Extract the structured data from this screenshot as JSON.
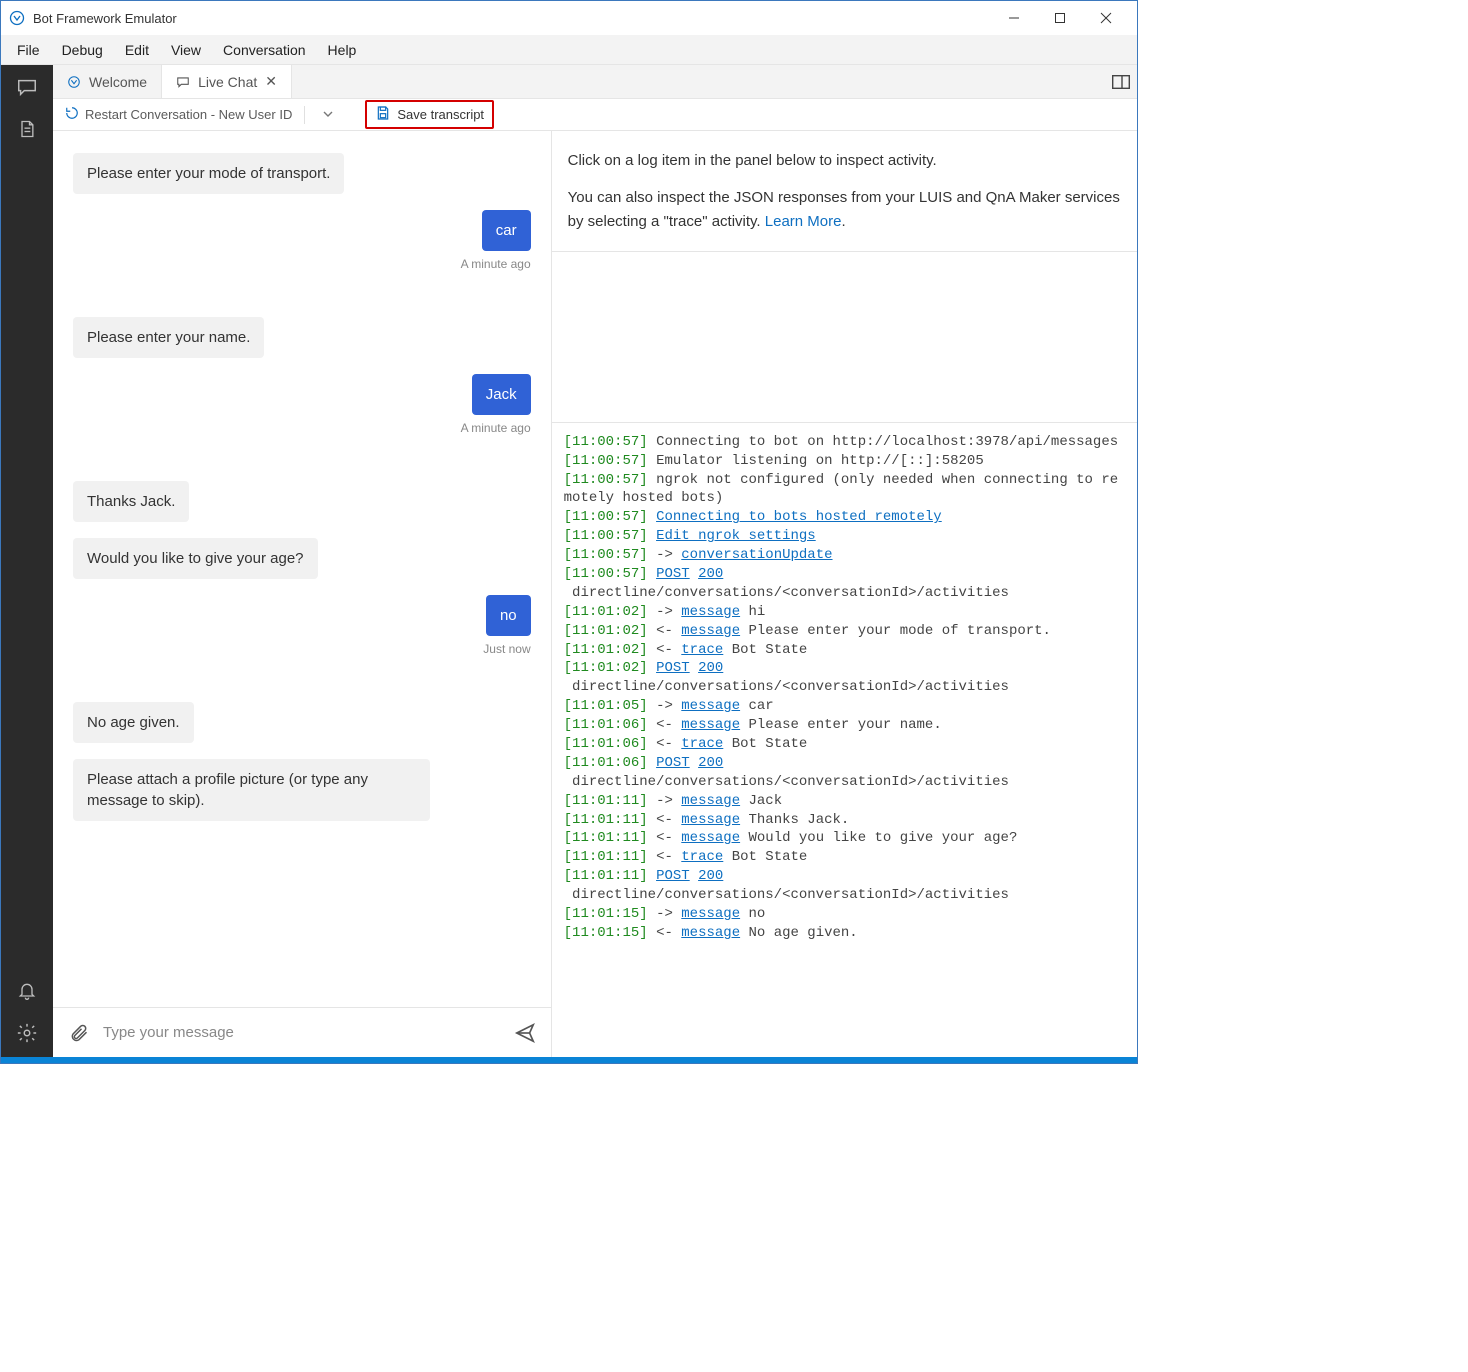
{
  "window": {
    "title": "Bot Framework Emulator"
  },
  "menu": {
    "items": [
      "File",
      "Debug",
      "Edit",
      "View",
      "Conversation",
      "Help"
    ]
  },
  "tabs": {
    "welcome": "Welcome",
    "livechat": "Live Chat"
  },
  "toolbar": {
    "restart": "Restart Conversation - New User ID",
    "save_transcript": "Save transcript"
  },
  "chat": {
    "messages": [
      {
        "side": "bot",
        "text": "Please enter your mode of transport."
      },
      {
        "side": "user",
        "text": "car",
        "ts": "A minute ago"
      },
      {
        "side": "bot",
        "text": "Please enter your name."
      },
      {
        "side": "user",
        "text": "Jack",
        "ts": "A minute ago"
      },
      {
        "side": "bot",
        "text": "Thanks Jack."
      },
      {
        "side": "bot",
        "text": "Would you like to give your age?"
      },
      {
        "side": "user",
        "text": "no",
        "ts": "Just now"
      },
      {
        "side": "bot",
        "text": "No age given."
      },
      {
        "side": "bot",
        "text": "Please attach a profile picture (or type any message to skip)."
      }
    ],
    "input_placeholder": "Type your message"
  },
  "inspect": {
    "line1": "Click on a log item in the panel below to inspect activity.",
    "line2_a": "You can also inspect the JSON responses from your LUIS and QnA Maker services by selecting a \"trace\" activity. ",
    "learn_more": "Learn More",
    "period": "."
  },
  "log": {
    "entries": [
      {
        "t": "11:00:57",
        "parts": [
          {
            "v": "Connecting to bot on http://localhost:3978/api/messages"
          }
        ]
      },
      {
        "t": "11:00:57",
        "parts": [
          {
            "v": "Emulator listening on http://[::]:58205"
          }
        ]
      },
      {
        "t": "11:00:57",
        "parts": [
          {
            "v": "ngrok not configured (only needed when connecting to remotely hosted bots)"
          }
        ]
      },
      {
        "t": "11:00:57",
        "parts": [
          {
            "v": "Connecting to bots hosted remotely",
            "link": true
          }
        ]
      },
      {
        "t": "11:00:57",
        "parts": [
          {
            "v": "Edit ngrok settings",
            "link": true
          }
        ]
      },
      {
        "t": "11:00:57",
        "parts": [
          {
            "v": "-> "
          },
          {
            "v": "conversationUpdate",
            "link": true
          }
        ]
      },
      {
        "t": "11:00:57",
        "parts": [
          {
            "v": "POST",
            "link": true
          },
          {
            "v": " "
          },
          {
            "v": "200",
            "link": true
          }
        ],
        "tail": " directline/conversations/<conversationId>/activities"
      },
      {
        "t": "11:01:02",
        "parts": [
          {
            "v": "-> "
          },
          {
            "v": "message",
            "link": true
          },
          {
            "v": " hi"
          }
        ]
      },
      {
        "t": "11:01:02",
        "parts": [
          {
            "v": "<- "
          },
          {
            "v": "message",
            "link": true
          },
          {
            "v": " Please enter your mode of transport."
          }
        ]
      },
      {
        "t": "11:01:02",
        "parts": [
          {
            "v": "<- "
          },
          {
            "v": "trace",
            "link": true
          },
          {
            "v": " Bot State"
          }
        ]
      },
      {
        "t": "11:01:02",
        "parts": [
          {
            "v": "POST",
            "link": true
          },
          {
            "v": " "
          },
          {
            "v": "200",
            "link": true
          }
        ],
        "tail": " directline/conversations/<conversationId>/activities"
      },
      {
        "t": "11:01:05",
        "parts": [
          {
            "v": "-> "
          },
          {
            "v": "message",
            "link": true
          },
          {
            "v": " car"
          }
        ]
      },
      {
        "t": "11:01:06",
        "parts": [
          {
            "v": "<- "
          },
          {
            "v": "message",
            "link": true
          },
          {
            "v": " Please enter your name."
          }
        ]
      },
      {
        "t": "11:01:06",
        "parts": [
          {
            "v": "<- "
          },
          {
            "v": "trace",
            "link": true
          },
          {
            "v": " Bot State"
          }
        ]
      },
      {
        "t": "11:01:06",
        "parts": [
          {
            "v": "POST",
            "link": true
          },
          {
            "v": " "
          },
          {
            "v": "200",
            "link": true
          }
        ],
        "tail": " directline/conversations/<conversationId>/activities"
      },
      {
        "t": "11:01:11",
        "parts": [
          {
            "v": "-> "
          },
          {
            "v": "message",
            "link": true
          },
          {
            "v": " Jack"
          }
        ]
      },
      {
        "t": "11:01:11",
        "parts": [
          {
            "v": "<- "
          },
          {
            "v": "message",
            "link": true
          },
          {
            "v": " Thanks Jack."
          }
        ]
      },
      {
        "t": "11:01:11",
        "parts": [
          {
            "v": "<- "
          },
          {
            "v": "message",
            "link": true
          },
          {
            "v": " Would you like to give your age?"
          }
        ]
      },
      {
        "t": "11:01:11",
        "parts": [
          {
            "v": "<- "
          },
          {
            "v": "trace",
            "link": true
          },
          {
            "v": " Bot State"
          }
        ]
      },
      {
        "t": "11:01:11",
        "parts": [
          {
            "v": "POST",
            "link": true
          },
          {
            "v": " "
          },
          {
            "v": "200",
            "link": true
          }
        ],
        "tail": " directline/conversations/<conversationId>/activities"
      },
      {
        "t": "11:01:15",
        "parts": [
          {
            "v": "-> "
          },
          {
            "v": "message",
            "link": true
          },
          {
            "v": " no"
          }
        ]
      },
      {
        "t": "11:01:15",
        "parts": [
          {
            "v": "<- "
          },
          {
            "v": "message",
            "link": true
          },
          {
            "v": " No age given."
          }
        ]
      }
    ]
  }
}
